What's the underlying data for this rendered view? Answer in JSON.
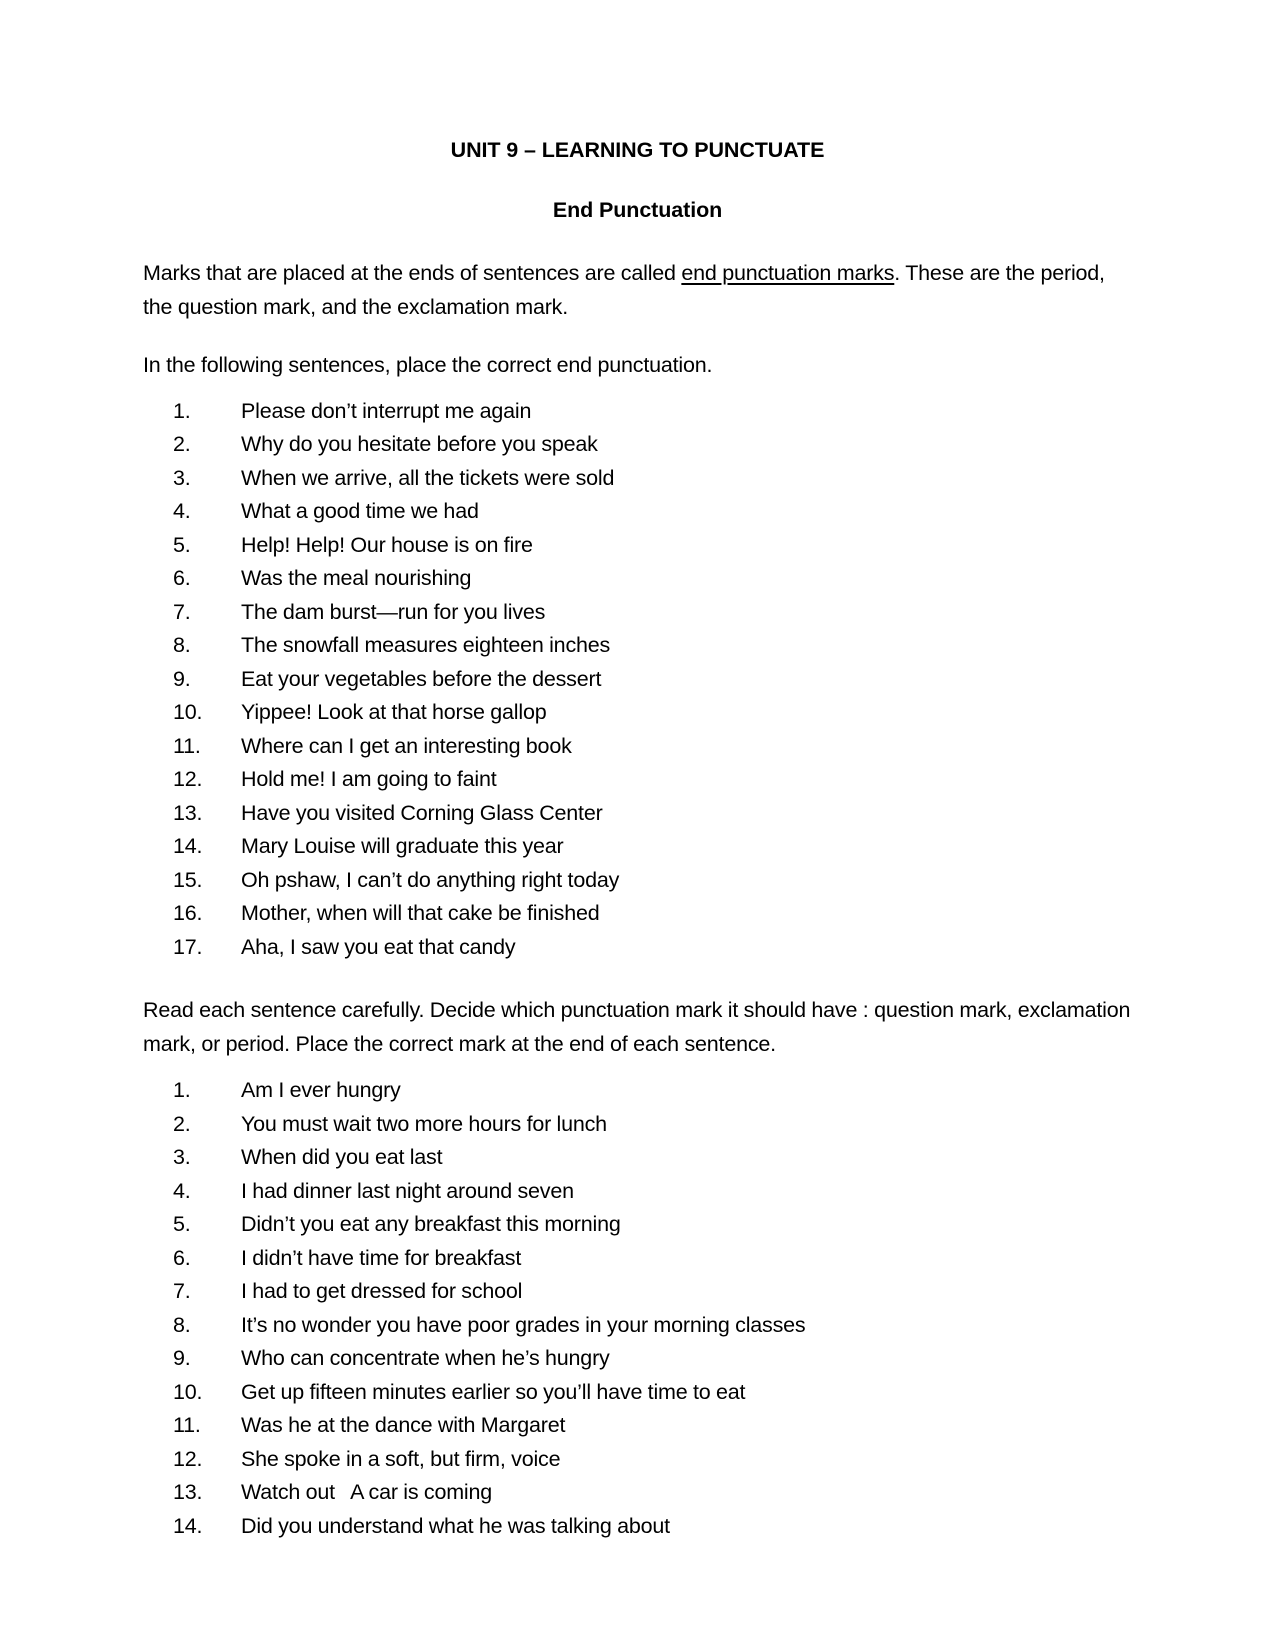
{
  "document": {
    "title": "UNIT 9 – LEARNING TO PUNCTUATE",
    "subtitle": "End Punctuation",
    "intro_paragraph": {
      "before_underline": "Marks that are placed at the ends of sentences are called ",
      "underlined_term": "end punctuation marks",
      "after_underline": ". These are the period, the question mark, and the exclamation mark."
    },
    "instruction_one": "In the following sentences, place the correct end punctuation.",
    "exercise_one": [
      "Please don’t interrupt me again",
      "Why do you hesitate before you speak",
      "When we arrive, all the tickets were sold",
      "What a good time we had",
      "Help! Help! Our house is on fire",
      "Was the meal nourishing",
      "The dam burst—run for you lives",
      "The snowfall measures eighteen inches",
      "Eat your vegetables before the dessert",
      "Yippee! Look at that horse gallop",
      "Where can I get an interesting book",
      "Hold me! I am going to faint",
      "Have you visited Corning Glass Center",
      "Mary Louise will graduate this year",
      "Oh pshaw, I can’t do anything right today",
      "Mother, when will that cake be finished",
      "Aha, I saw you eat that candy"
    ],
    "instruction_two": "Read each sentence carefully. Decide which punctuation mark it should have : question mark, exclamation mark, or period. Place the correct mark at the end of each sentence.",
    "exercise_two": [
      "Am I ever hungry",
      "You must wait two more hours for lunch",
      "When did you eat last",
      "I had dinner last night around seven",
      "Didn’t you eat any breakfast this morning",
      "I didn’t have time for breakfast",
      "I had to get dressed for school",
      "It’s no wonder you have poor grades in your morning classes",
      "Who can concentrate when he’s hungry",
      "Get up fifteen minutes earlier so you’ll have time to eat",
      "Was he at the dance with Margaret",
      "She spoke in a soft, but firm, voice",
      "Watch out   A car is coming",
      "Did you understand what he was talking about"
    ]
  }
}
